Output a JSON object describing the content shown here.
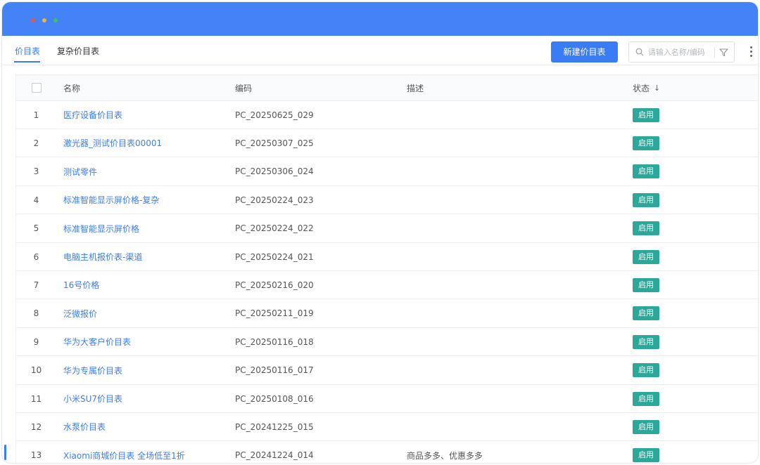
{
  "tabs": [
    {
      "label": "价目表",
      "active": true
    },
    {
      "label": "复杂价目表",
      "active": false
    }
  ],
  "toolbar": {
    "new_button": "新建价目表",
    "search_placeholder": "请输入名称/编码"
  },
  "table": {
    "columns": {
      "name": "名称",
      "code": "编码",
      "desc": "描述",
      "status": "状态"
    },
    "sort_indicator": "↓",
    "rows": [
      {
        "idx": "1",
        "name": "医疗设备价目表",
        "code": "PC_20250625_029",
        "desc": "",
        "status": "启用"
      },
      {
        "idx": "2",
        "name": "激光器_测试价目表00001",
        "code": "PC_20250307_025",
        "desc": "",
        "status": "启用"
      },
      {
        "idx": "3",
        "name": "测试零件",
        "code": "PC_20250306_024",
        "desc": "",
        "status": "启用"
      },
      {
        "idx": "4",
        "name": "标准智能显示屏价格-复杂",
        "code": "PC_20250224_023",
        "desc": "",
        "status": "启用"
      },
      {
        "idx": "5",
        "name": "标准智能显示屏价格",
        "code": "PC_20250224_022",
        "desc": "",
        "status": "启用"
      },
      {
        "idx": "6",
        "name": "电脑主机报价表-渠道",
        "code": "PC_20250224_021",
        "desc": "",
        "status": "启用"
      },
      {
        "idx": "7",
        "name": "16号价格",
        "code": "PC_20250216_020",
        "desc": "",
        "status": "启用"
      },
      {
        "idx": "8",
        "name": "泛微报价",
        "code": "PC_20250211_019",
        "desc": "",
        "status": "启用"
      },
      {
        "idx": "9",
        "name": "华为大客户价目表",
        "code": "PC_20250116_018",
        "desc": "",
        "status": "启用"
      },
      {
        "idx": "10",
        "name": "华为专属价目表",
        "code": "PC_20250116_017",
        "desc": "",
        "status": "启用"
      },
      {
        "idx": "11",
        "name": "小米SU7价目表",
        "code": "PC_20250108_016",
        "desc": "",
        "status": "启用"
      },
      {
        "idx": "12",
        "name": "水泵价目表",
        "code": "PC_20241225_015",
        "desc": "",
        "status": "启用"
      },
      {
        "idx": "13",
        "name": "Xiaomi商城价目表 全场低至1折",
        "code": "PC_20241224_014",
        "desc": "商品多多、优惠多多",
        "status": "启用"
      }
    ]
  },
  "colors": {
    "titlebar": "#4382f7",
    "accent": "#3a7cf6",
    "status_badge": "#2ba899"
  }
}
